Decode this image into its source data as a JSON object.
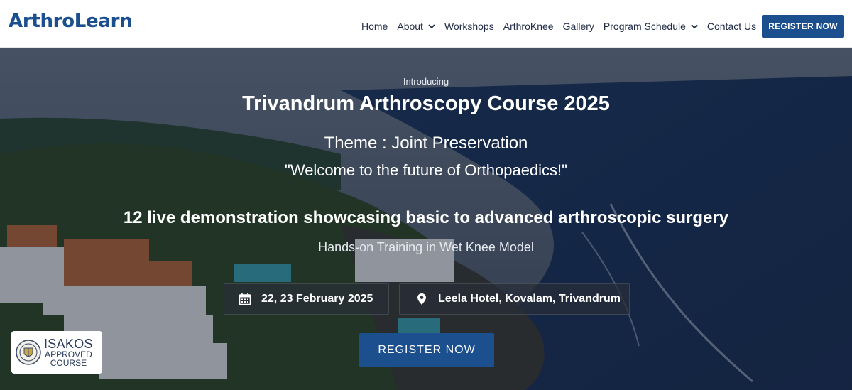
{
  "header": {
    "logo": "ArthroLearn",
    "nav": [
      {
        "label": "Home"
      },
      {
        "label": "About",
        "has_dropdown": true
      },
      {
        "label": "Workshops"
      },
      {
        "label": "ArthroKnee"
      },
      {
        "label": "Gallery"
      },
      {
        "label": "Program Schedule",
        "has_dropdown": true
      },
      {
        "label": "Contact Us"
      }
    ],
    "register_label": "REGISTER NOW"
  },
  "hero": {
    "intro": "Introducing",
    "title": "Trivandrum Arthroscopy Course 2025",
    "theme": "Theme : Joint Preservation",
    "welcome": "\"Welcome to the future of Orthopaedics!\"",
    "demo": "12 live demonstration showcasing basic to advanced arthroscopic surgery",
    "handson": "Hands-on Training in Wet Knee Model",
    "date": "22, 23 February 2025",
    "venue": "Leela Hotel, Kovalam, Trivandrum",
    "register_label": "REGISTER NOW"
  },
  "badge": {
    "line1": "ISAKOS",
    "line2": "APPROVED",
    "line3": "COURSE"
  },
  "colors": {
    "brand": "#1b4f8e",
    "nav_text": "#1f2a44",
    "info_box_bg": "rgba(40,46,56,0.72)"
  },
  "icons": {
    "chevron": "chevron-down-icon",
    "calendar": "calendar-icon",
    "location": "location-pin-icon",
    "seal": "isakos-seal-icon"
  }
}
